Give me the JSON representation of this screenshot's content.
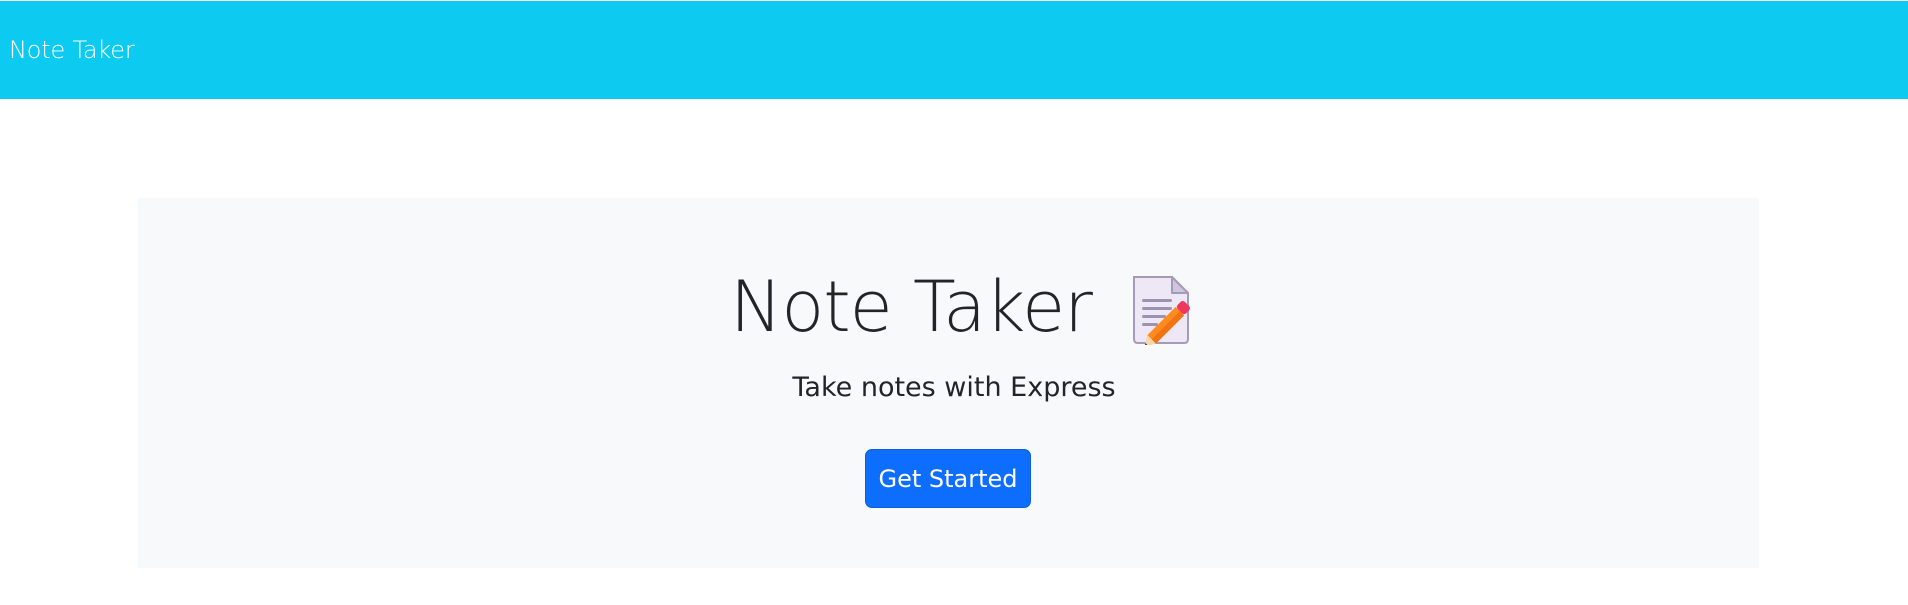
{
  "navbar": {
    "brand": "Note Taker",
    "color": "#0dcaf0"
  },
  "hero": {
    "title": "Note Taker",
    "icon": "memo-pencil-icon",
    "subtitle": "Take notes with Express",
    "button_label": "Get Started",
    "button_color": "#0d6efd",
    "background": "#f8f9fa"
  }
}
